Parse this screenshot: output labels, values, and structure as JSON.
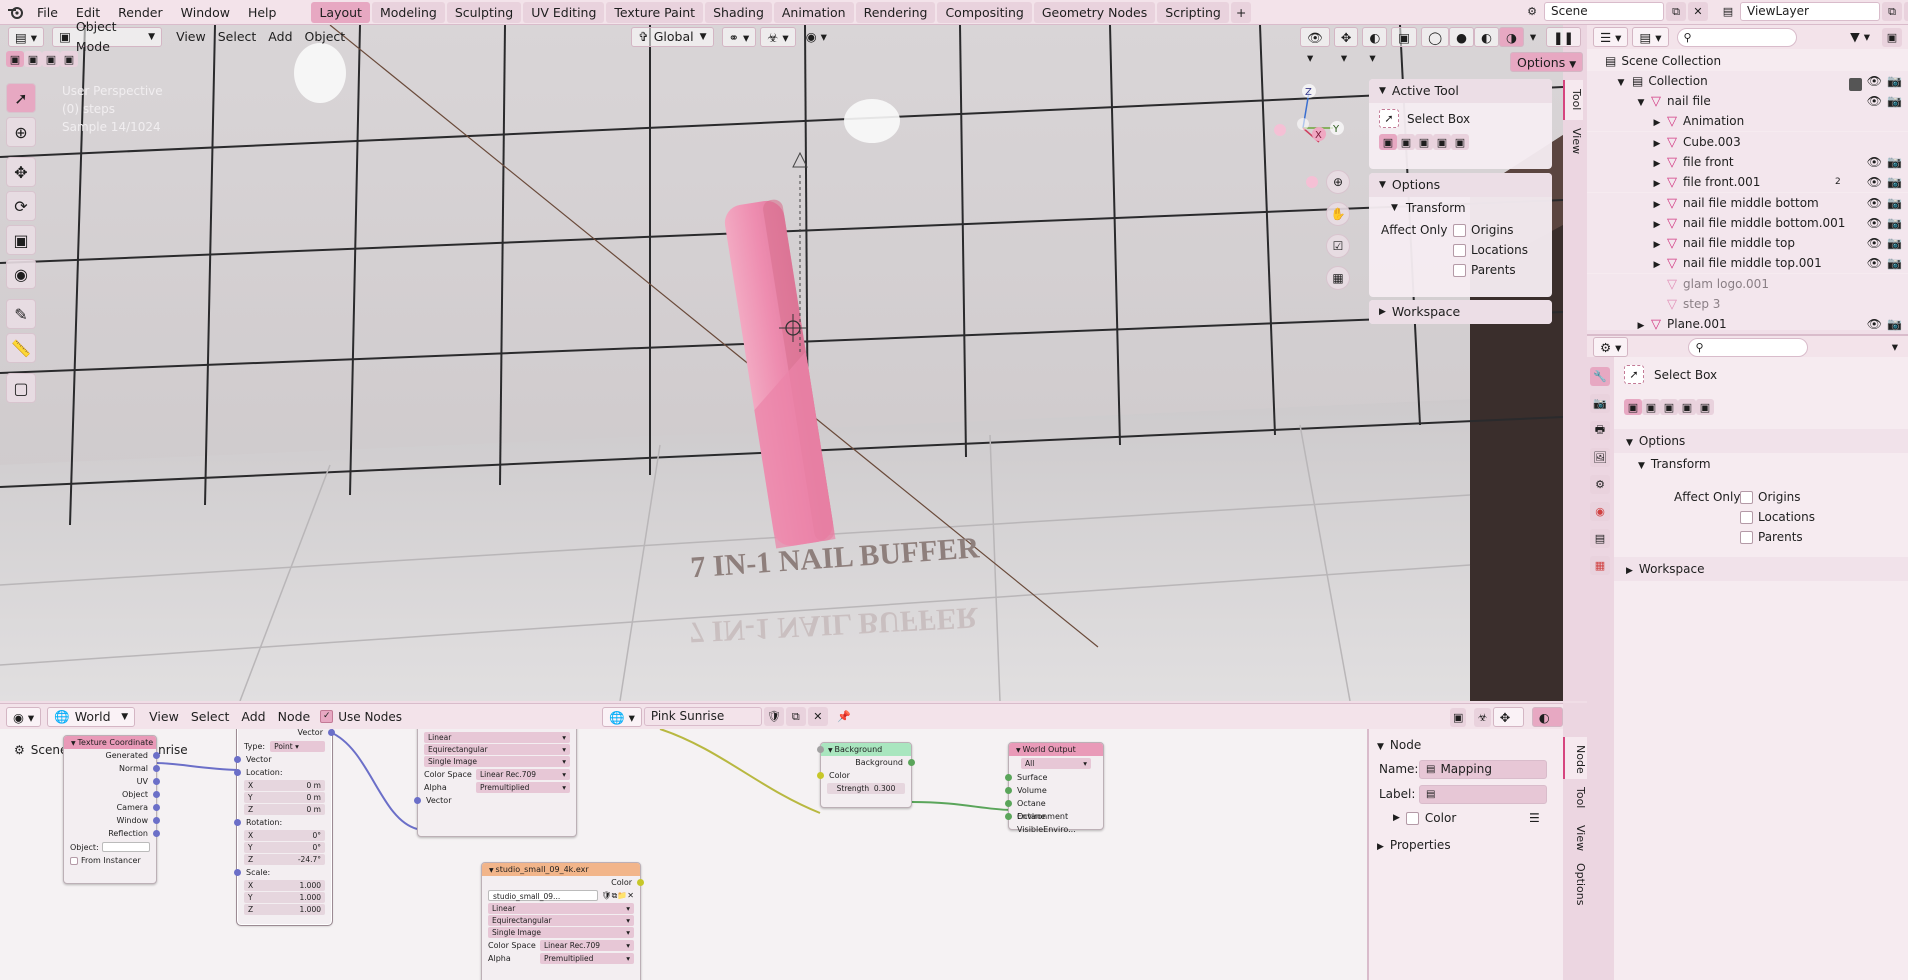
{
  "topbar": {
    "menus": [
      "File",
      "Edit",
      "Render",
      "Window",
      "Help"
    ],
    "workspaces": [
      "Layout",
      "Modeling",
      "Sculpting",
      "UV Editing",
      "Texture Paint",
      "Shading",
      "Animation",
      "Rendering",
      "Compositing",
      "Geometry Nodes",
      "Scripting"
    ],
    "active_workspace": "Layout",
    "add_tab": "+",
    "scene": "Scene",
    "view_layer": "ViewLayer"
  },
  "viewport_header": {
    "mode": "Object Mode",
    "menus": [
      "View",
      "Select",
      "Add",
      "Object"
    ],
    "orientation": "Global",
    "options": "Options"
  },
  "viewport": {
    "overlay_lines": [
      "User Perspective",
      "(0) steps",
      "Sample 14/1024"
    ],
    "scene_text": "7 IN-1 NAIL BUFFER",
    "gizmo": {
      "x": "X",
      "y": "Y",
      "z": "Z"
    }
  },
  "npanel": {
    "active_tool_title": "Active Tool",
    "tool_name": "Select Box",
    "options_title": "Options",
    "transform_title": "Transform",
    "affect_only": "Affect Only",
    "checkboxes": [
      "Origins",
      "Locations",
      "Parents"
    ],
    "workspace_title": "Workspace",
    "tabs": [
      "Tool",
      "View"
    ]
  },
  "outliner": {
    "root": "Scene Collection",
    "collection": "Collection",
    "items": [
      {
        "name": "nail file",
        "level": 1,
        "open": true,
        "dim": false
      },
      {
        "name": "Animation",
        "level": 2,
        "open": false,
        "dim": false
      },
      {
        "name": "Cube.003",
        "level": 2,
        "open": false,
        "dim": false
      },
      {
        "name": "file front",
        "level": 2,
        "open": false,
        "dim": false
      },
      {
        "name": "file front.001",
        "level": 2,
        "open": false,
        "dim": false
      },
      {
        "name": "nail file middle bottom",
        "level": 2,
        "open": false,
        "dim": false
      },
      {
        "name": "nail file middle bottom.001",
        "level": 2,
        "open": false,
        "dim": false
      },
      {
        "name": "nail file middle top",
        "level": 2,
        "open": false,
        "dim": false
      },
      {
        "name": "nail file middle top.001",
        "level": 2,
        "open": false,
        "dim": false
      },
      {
        "name": "glam logo.001",
        "level": 2,
        "open": false,
        "dim": true
      },
      {
        "name": "step 3",
        "level": 2,
        "open": false,
        "dim": true
      },
      {
        "name": "Plane.001",
        "level": 1,
        "open": false,
        "dim": false
      }
    ],
    "badge_count": "2"
  },
  "properties": {
    "tool_name": "Select Box",
    "options_title": "Options",
    "transform_title": "Transform",
    "affect_only": "Affect Only",
    "checkboxes": [
      "Origins",
      "Locations",
      "Parents"
    ],
    "workspace_title": "Workspace"
  },
  "node_header": {
    "type": "World",
    "menus": [
      "View",
      "Select",
      "Add",
      "Node"
    ],
    "use_nodes": "Use Nodes",
    "world_name": "Pink Sunrise",
    "breadcrumb": [
      "Scene",
      "Pink Sunrise"
    ]
  },
  "nodes": {
    "texcoord": {
      "title": "Texture Coordinate",
      "outputs": [
        "Generated",
        "Normal",
        "UV",
        "Object",
        "Camera",
        "Window",
        "Reflection"
      ],
      "object_label": "Object:",
      "from_instancer": "From Instancer"
    },
    "mapping": {
      "out": "Vector",
      "type_label": "Type:",
      "type_value": "Point",
      "vector": "Vector",
      "location": "Location:",
      "rotation": "Rotation:",
      "scale": "Scale:",
      "loc": [
        [
          "X",
          "0 m"
        ],
        [
          "Y",
          "0 m"
        ],
        [
          "Z",
          "0 m"
        ]
      ],
      "rot": [
        [
          "X",
          "0°"
        ],
        [
          "Y",
          "0°"
        ],
        [
          "Z",
          "-24.7°"
        ]
      ],
      "scl": [
        [
          "X",
          "1.000"
        ],
        [
          "Y",
          "1.000"
        ],
        [
          "Z",
          "1.000"
        ]
      ]
    },
    "envtex1": {
      "rows": [
        "Linear",
        "Equirectangular",
        "Single Image"
      ],
      "colorspace_label": "Color Space",
      "colorspace": "Linear Rec.709",
      "alpha_label": "Alpha",
      "alpha": "Premultiplied",
      "vector": "Vector"
    },
    "envtex2": {
      "title": "studio_small_09_4k.exr",
      "color": "Color",
      "image": "studio_small_09...",
      "rows": [
        "Linear",
        "Equirectangular",
        "Single Image"
      ],
      "colorspace_label": "Color Space",
      "colorspace": "Linear Rec.709",
      "alpha_label": "Alpha",
      "alpha": "Premultiplied"
    },
    "background": {
      "title": "Background",
      "out": "Background",
      "color": "Color",
      "strength_label": "Strength",
      "strength": "0.300"
    },
    "world_output": {
      "title": "World Output",
      "target": "All",
      "inputs": [
        "Surface",
        "Volume",
        "Octane Environment",
        "Octane VisibleEnviro..."
      ]
    }
  },
  "node_side": {
    "node_title": "Node",
    "name_label": "Name:",
    "name_value": "Mapping",
    "label_label": "Label:",
    "label_value": "",
    "color": "Color",
    "properties": "Properties",
    "tabs": [
      "Node",
      "Tool",
      "View",
      "Options"
    ]
  },
  "colors": {
    "accent": "#e7a8c2",
    "header": "#f3e3ea",
    "mesh": "#d23a83"
  }
}
